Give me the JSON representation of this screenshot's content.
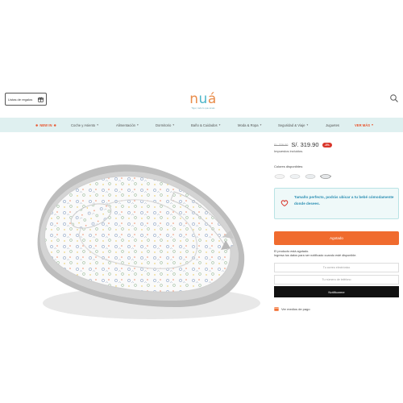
{
  "header": {
    "gift_label": "Listas de regalos",
    "logo_text": [
      "n",
      "u",
      "á"
    ],
    "logo_tagline": "Tiger, todo lo que amas"
  },
  "nav": {
    "new": "NEW IN",
    "items": [
      "Coche y Asiento",
      "Alimentación",
      "Dormitorio",
      "Baño & Cuidados",
      "Moda & Ropa",
      "Seguridad & Viaje",
      "Juguetes"
    ],
    "more": "VER MÁS"
  },
  "product": {
    "old_price": "S/. 329.00",
    "price": "S/. 319.90",
    "discount_badge": "-3%",
    "tax_note": "Impuestos incluidos.",
    "colors_label": "Colores disponibles:",
    "swatch_colors": [
      "#f3f3f3",
      "#eef1f3",
      "#e9ecee",
      "#e4e6e8"
    ],
    "notice_text": "Tamaño perfecto, podrás ubicar a tu bebé cómodamente donde desees.",
    "sold_out_button": "Agotado",
    "stock_message": "El producto está agotado.",
    "stock_sub": "Ingresa tus datos para ser notificado cuando esté disponible.",
    "email_placeholder": "Tu correo electrónico",
    "phone_placeholder": "Tu número de teléfono",
    "notify_button": "Notificarme",
    "payment_link": "Ver medios de pago"
  },
  "colors": {
    "accent_orange": "#f06b2e",
    "nav_bg": "#dff0f0",
    "notice_text": "#2c8fb3",
    "badge_red": "#d9352a"
  }
}
